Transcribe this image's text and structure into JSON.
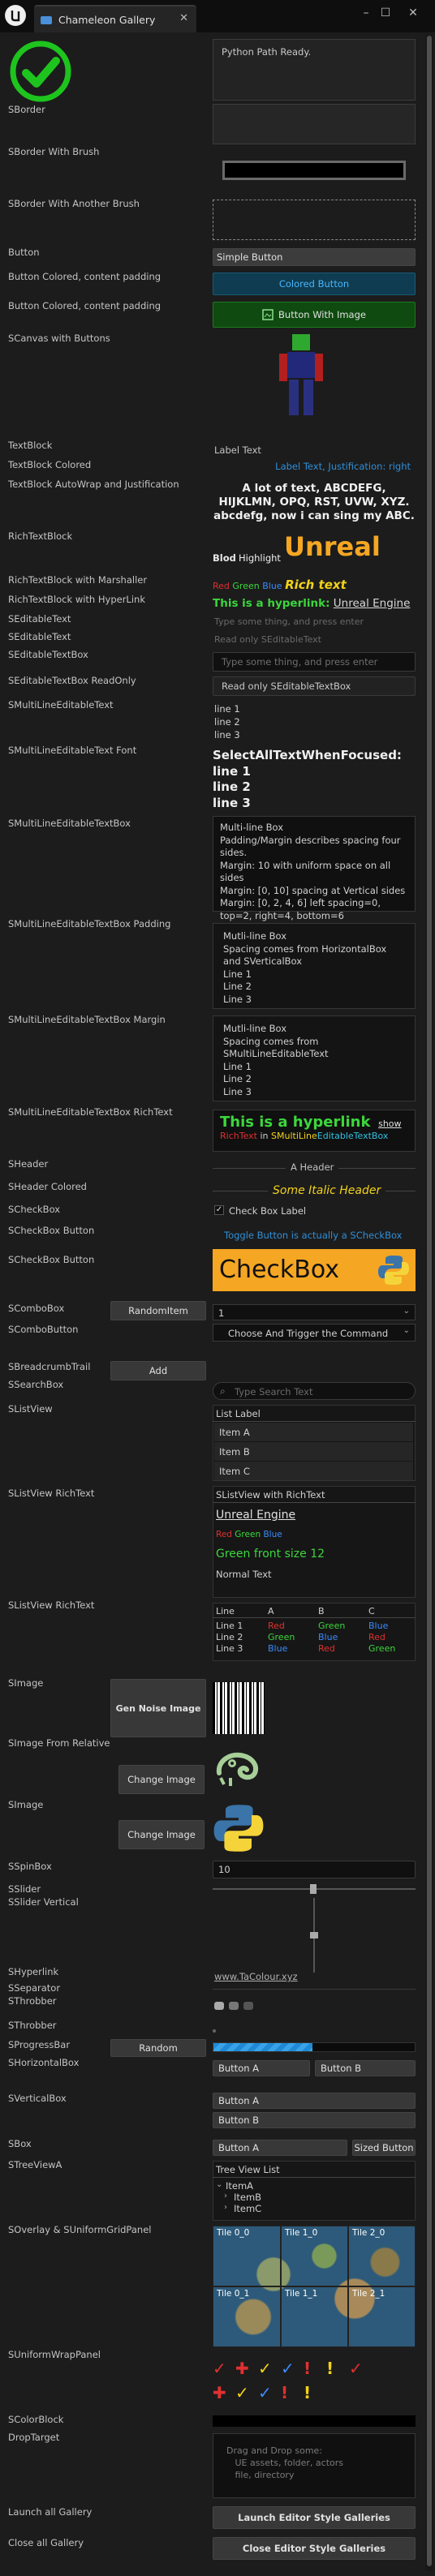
{
  "window": {
    "title": "Chameleon Gallery",
    "min_icon": "–",
    "max_icon": "☐",
    "close_icon": "✕",
    "tab_close_icon": "✕"
  },
  "labels": {
    "sborder": "SBorder",
    "sborder_brush": "SBorder With Brush",
    "sborder_another": "SBorder With Another Brush",
    "button": "Button",
    "button_colored": "Button Colored, content padding",
    "button_colored2": "Button Colored, content padding",
    "scanvas": "SCanvas with Buttons",
    "textblock": "TextBlock",
    "textblock_colored": "TextBlock Colored",
    "textblock_autowrap": "TextBlock AutoWrap and Justification",
    "richtextblock": "RichTextBlock",
    "richtext_marshaller": "RichTextBlock with Marshaller",
    "richtext_hyperlink": "RichTextBlock with HyperLink",
    "seditabletext1": "SEditableText",
    "seditabletext2": "SEditableText",
    "seditabletextbox": "SEditableTextBox",
    "seditabletextbox_ro": "SEditableTextBox ReadOnly",
    "smultiline": "SMultiLineEditableText",
    "smultiline_font": "SMultiLineEditableText Font",
    "smultiline_box": "SMultiLineEditableTextBox",
    "smultiline_box_padding": "SMultiLineEditableTextBox Padding",
    "smultiline_box_margin": "SMultiLineEditableTextBox Margin",
    "smultiline_box_rich": "SMultiLineEditableTextBox RichText",
    "sheader": "SHeader",
    "sheader_colored": "SHeader Colored",
    "scheckbox": "SCheckBox",
    "scheckbox_button": "SCheckBox Button",
    "scheckbox_button2": "SCheckBox Button",
    "scombobox": "SComboBox",
    "scombobutton": "SComboButton",
    "sbreadcrumb": "SBreadcrumbTrail",
    "ssearchbox": "SSearchBox",
    "slistview": "SListView",
    "slistview_rich": "SListView RichText",
    "slistview_rich2": "SListView RichText",
    "simage": "SImage",
    "simage_relative": "SImage From Relative",
    "simage2": "SImage",
    "sspinbox": "SSpinBox",
    "sslider": "SSlider",
    "sslider_vertical": "SSlider Vertical",
    "shyperlink": "SHyperlink",
    "sseparator": "SSeparator",
    "sthrobber": "SThrobber",
    "sthrobber2": "SThrobber",
    "sprogressbar": "SProgressBar",
    "shorizontalbox": "SHorizontalBox",
    "sverticalbox": "SVerticalBox",
    "sbox": "SBox",
    "streeviewa": "STreeViewA",
    "soverlay": "SOverlay & SUniformGridPanel",
    "suniformwrap": "SUniformWrapPanel",
    "scolorblock": "SColorBlock",
    "droptarget": "DropTarget",
    "launch_all": "Launch all Gallery",
    "close_all": "Close all Gallery"
  },
  "python_box": {
    "text": "Python Path Ready."
  },
  "buttons": {
    "simple": "Simple Button",
    "colored": "Colored Button",
    "with_image": "Button With Image",
    "random_item": "RandomItem",
    "add": "Add",
    "gen_noise": "Gen Noise Image",
    "change_image1": "Change Image",
    "change_image2": "Change Image",
    "random": "Random",
    "button_a1": "Button A",
    "button_b": "Button B",
    "button_a2": "Button A",
    "button_b2": "Button B",
    "button_a3": "Button A",
    "sized_button": "Sized Button",
    "launch_styles": "Launch Editor Style Galleries",
    "close_styles": "Close Editor Style Galleries"
  },
  "texts": {
    "label_text": "Label Text",
    "label_justified": "Label Text, Justification: right",
    "autowrap": "A lot of text, ABCDEFG, HIJKLMN, OPQ, RST, UVW, XYZ. abcdefg, now i can sing my ABC.",
    "rich_bold": "Blod",
    "rich_highlight": "Highlight",
    "rich_unreal": "Unreal",
    "m_red": "Red",
    "m_green": "Green",
    "m_blue": "Blue",
    "m_rich": "Rich text",
    "hyper_prefix": "This is a hyperlink:",
    "hyper_link": "Unreal Engine",
    "edit_placeholder": "Type some thing, and press enter",
    "edit_readonly": "Read only SEditableText",
    "edit_box_placeholder": "Type some thing, and press enter",
    "edit_box_readonly": "Read only SEditableTextBox",
    "multiline": "line 1\nline 2\nline 3",
    "multiline_font": "SelectAllTextWhenFocused:\nline 1\nline 2\nline 3",
    "multiline_box": "Multi-line Box\nPadding/Margin describes spacing four sides.\nMargin: 10 with uniform space on all sides\nMargin: [0, 10] spacing at Vertical sides\nMargin: [0, 2, 4, 6] left spacing=0, top=2, right=4, bottom=6",
    "multiline_padding": "Mutli-line Box\nSpacing comes from HorizontalBox and SVerticalBox\nLine 1\nLine 2\nLine 3",
    "multiline_margin": "Mutli-line Box\nSpacing comes from SMultiLineEditableText\nLine 1\nLine 2\nLine 3",
    "rich_hyper": "This is a hyperlink",
    "rich_show": "show",
    "rich_red": "RichText",
    "rich_in": " in ",
    "rich_yellow": "SMultiLine",
    "rich_cyan": "EditableTextBox",
    "header": "A Header",
    "header_italic": "Some Italic Header",
    "checkbox_label": "Check Box Label",
    "toggle_text": "Toggle Button is actually a SCheckBox",
    "big_checkbox": "CheckBox",
    "combo_value": "1",
    "combo_button": "Choose And Trigger the Command",
    "search_placeholder": "Type Search Text",
    "list_label": "List Label",
    "list_items": [
      "Item A",
      "Item B",
      "Item C"
    ],
    "list_rich_header": "SListView with RichText",
    "list_rich_unreal": "Unreal Engine",
    "list_rich_red": "Red",
    "list_rich_green": "Green",
    "list_rich_blue": "Blue",
    "list_rich_font": "Green front size 12",
    "list_rich_normal": "Normal Text",
    "table_header": [
      "Line",
      "A",
      "B",
      "C"
    ],
    "table_rows": [
      [
        "Line 1",
        "Red",
        "Green",
        "Blue"
      ],
      [
        "Line 2",
        "Green",
        "Blue",
        "Red"
      ],
      [
        "Line 3",
        "Blue",
        "Red",
        "Green"
      ]
    ],
    "spin_value": "10",
    "hyperlink": "www.TaColour.xyz",
    "tree_header": "Tree View List",
    "tree_root": "ItemA",
    "tree_children": [
      "ItemB",
      "ItemC"
    ],
    "tiles": [
      "Tile 0_0",
      "Tile 1_0",
      "Tile 2_0",
      "Tile 0_1",
      "Tile 1_1",
      "Tile 2_1"
    ],
    "drop_text": "Drag and Drop some:\n   UE assets, folder, actors\n   file, directory"
  },
  "colors": {
    "accent": "#f5a623",
    "link": "#2f8fd8",
    "green": "#3cd63c",
    "red": "#e03030",
    "blue": "#3a8bff"
  },
  "progress": 0.49
}
